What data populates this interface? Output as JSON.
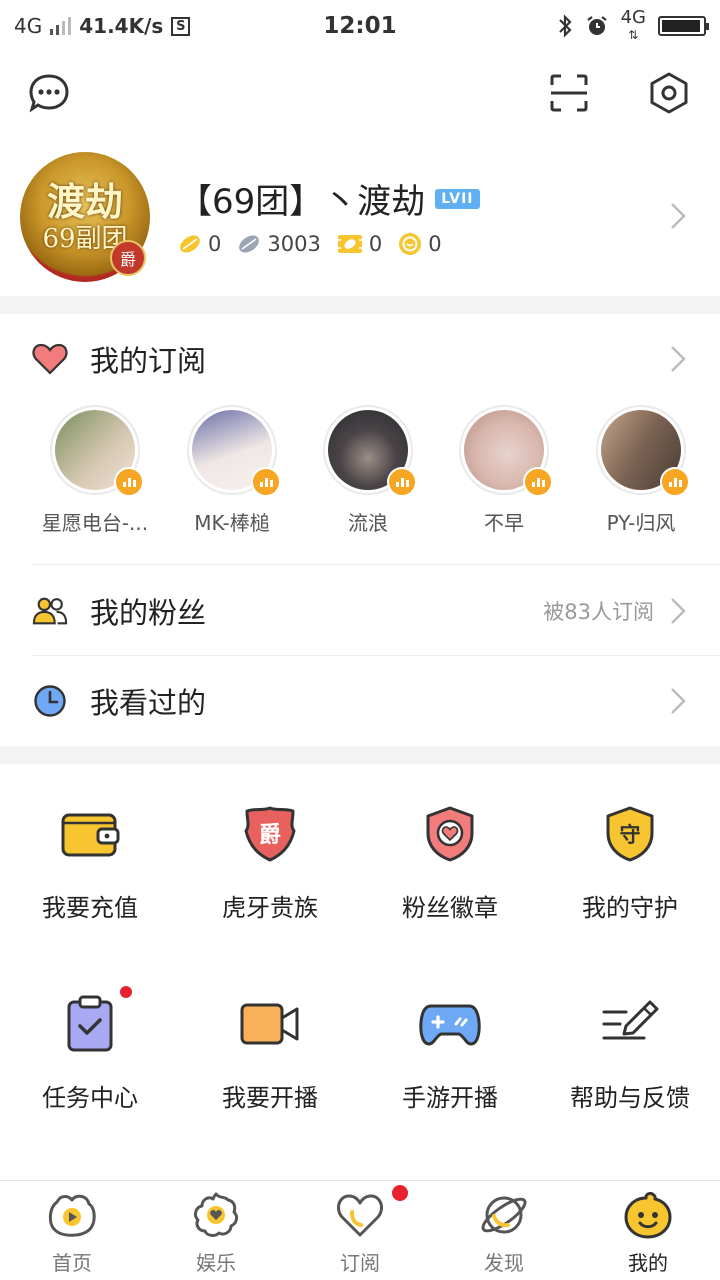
{
  "status_bar": {
    "network": "4G",
    "speed": "41.4K/s",
    "storage_icon": "S",
    "time": "12:01",
    "network_right": "4G",
    "battery_level": 0.95
  },
  "toolbar": {
    "icons": [
      "message-icon",
      "scan-icon",
      "settings-icon"
    ]
  },
  "profile": {
    "avatar_text_top": "渡劫",
    "avatar_text_bottom": "69副团",
    "avatar_badge": "爵",
    "name": "【69团】丶渡劫",
    "level": "LVII",
    "stats": [
      {
        "icon": "gold-bean-icon",
        "value": "0"
      },
      {
        "icon": "silver-bean-icon",
        "value": "3003"
      },
      {
        "icon": "ticket-icon",
        "value": "0"
      },
      {
        "icon": "coin-icon",
        "value": "0"
      }
    ]
  },
  "subscriptions": {
    "title": "我的订阅",
    "items": [
      {
        "name": "星愿电台-...",
        "color_a": "#7a8f5e",
        "color_b": "#d8c9b4"
      },
      {
        "name": "MK-棒槌",
        "color_a": "#6a6fa8",
        "color_b": "#efe7e5"
      },
      {
        "name": "流浪",
        "color_a": "#2a2a2e",
        "color_b": "#9b8f86"
      },
      {
        "name": "不早",
        "color_a": "#e8d3cd",
        "color_b": "#b48b7e"
      },
      {
        "name": "PY-归风",
        "color_a": "#4a3c34",
        "color_b": "#c4a58a"
      }
    ]
  },
  "fans": {
    "label": "我的粉丝",
    "count_text": "被83人订阅"
  },
  "history": {
    "label": "我看过的"
  },
  "grid": [
    {
      "label": "我要充值",
      "icon": "wallet-icon"
    },
    {
      "label": "虎牙贵族",
      "icon": "noble-shield-icon",
      "glyph": "爵"
    },
    {
      "label": "粉丝徽章",
      "icon": "fan-badge-icon"
    },
    {
      "label": "我的守护",
      "icon": "guard-shield-icon",
      "glyph": "守"
    },
    {
      "label": "任务中心",
      "icon": "task-clipboard-icon"
    },
    {
      "label": "我要开播",
      "icon": "video-camera-icon"
    },
    {
      "label": "手游开播",
      "icon": "gamepad-icon"
    },
    {
      "label": "帮助与反馈",
      "icon": "feedback-pen-icon"
    }
  ],
  "bottom_nav": [
    {
      "label": "首页",
      "icon": "home-play-icon"
    },
    {
      "label": "娱乐",
      "icon": "entertainment-icon"
    },
    {
      "label": "订阅",
      "icon": "subscribe-heart-icon"
    },
    {
      "label": "发现",
      "icon": "discover-planet-icon"
    },
    {
      "label": "我的",
      "icon": "profile-face-icon",
      "active": true
    }
  ],
  "colors": {
    "accent": "#f6c52f",
    "badge_orange": "#f6a623",
    "red_dot": "#e8212e",
    "level_blue": "#5fb0f3"
  }
}
